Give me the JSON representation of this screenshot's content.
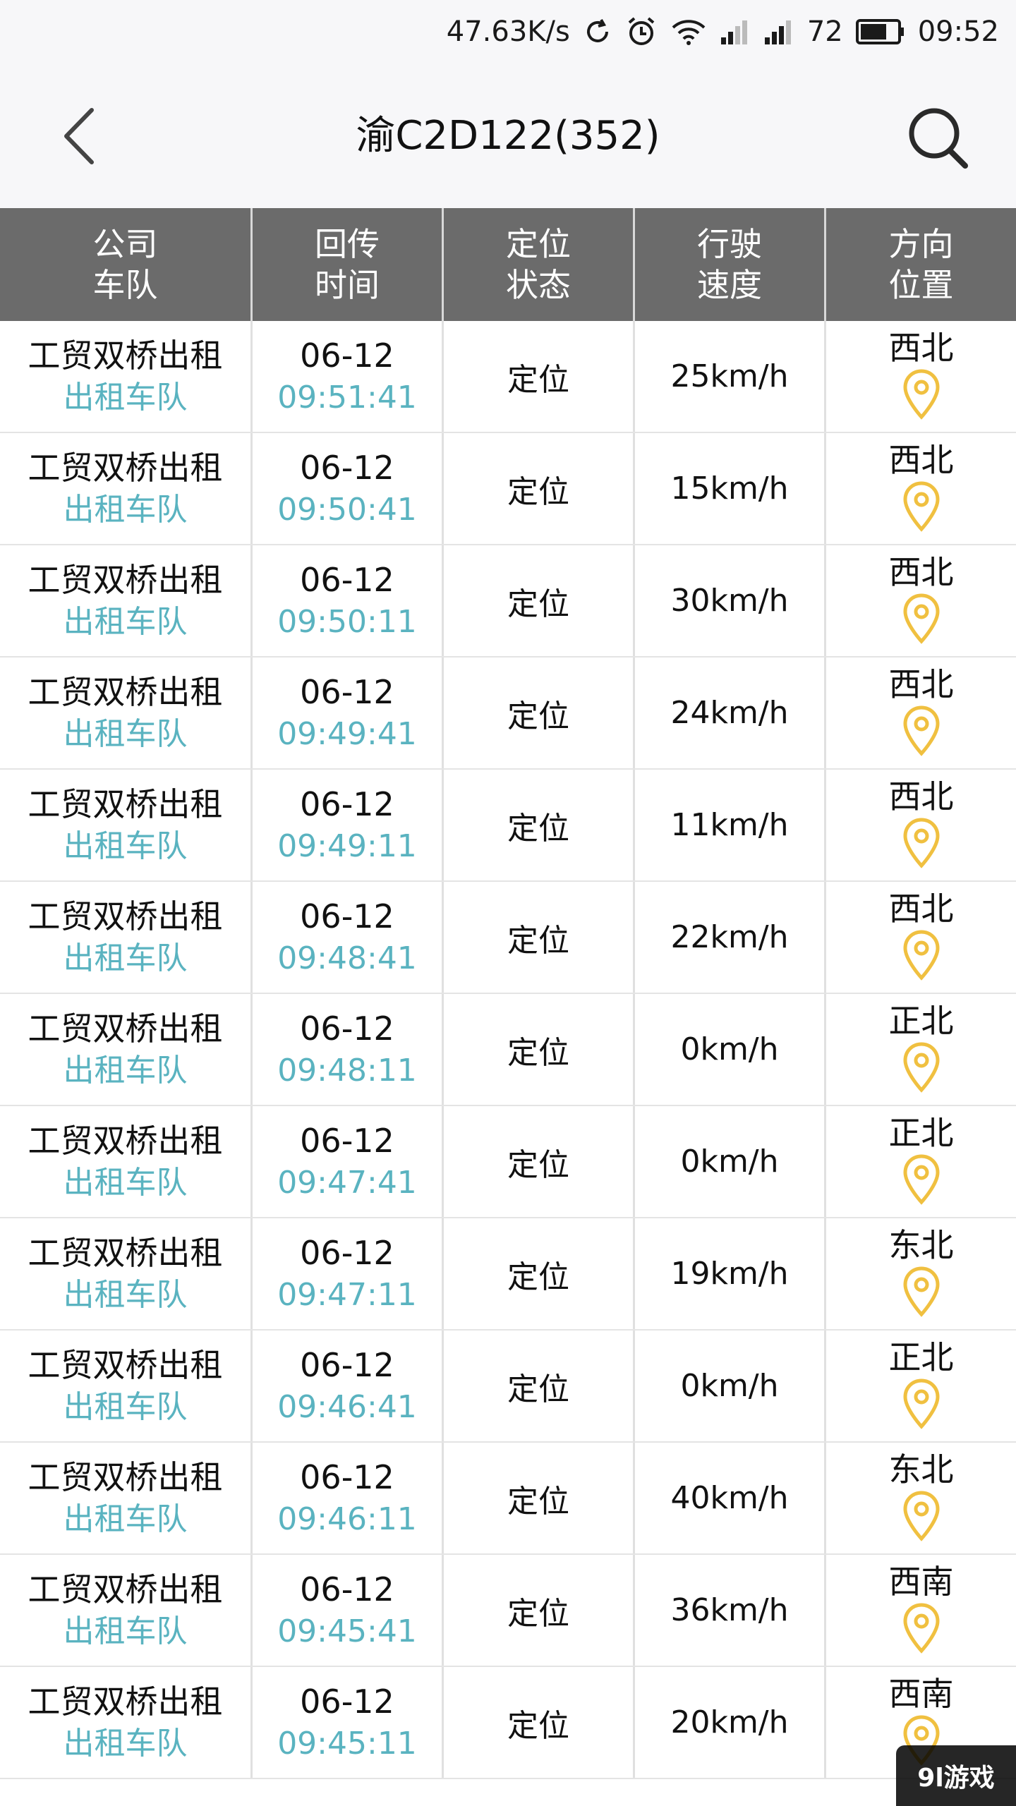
{
  "status_bar": {
    "net_speed": "47.63K/s",
    "battery": "72",
    "time": "09:52",
    "icons": [
      "sync-icon",
      "alarm-icon",
      "wifi-icon",
      "signal-1-icon",
      "signal-2-icon",
      "battery-icon"
    ]
  },
  "nav": {
    "title": "渝C2D122(352)",
    "back_icon": "chevron-left-icon",
    "search_icon": "search-icon"
  },
  "table": {
    "headers": [
      "公司\n车队",
      "回传\n时间",
      "定位\n状态",
      "行驶\n速度",
      "方向\n位置"
    ],
    "rows": [
      {
        "company": "工贸双桥出租",
        "team": "出租车队",
        "date": "06-12",
        "time": "09:51:41",
        "state": "定位",
        "speed": "25km/h",
        "direction": "西北"
      },
      {
        "company": "工贸双桥出租",
        "team": "出租车队",
        "date": "06-12",
        "time": "09:50:41",
        "state": "定位",
        "speed": "15km/h",
        "direction": "西北"
      },
      {
        "company": "工贸双桥出租",
        "team": "出租车队",
        "date": "06-12",
        "time": "09:50:11",
        "state": "定位",
        "speed": "30km/h",
        "direction": "西北"
      },
      {
        "company": "工贸双桥出租",
        "team": "出租车队",
        "date": "06-12",
        "time": "09:49:41",
        "state": "定位",
        "speed": "24km/h",
        "direction": "西北"
      },
      {
        "company": "工贸双桥出租",
        "team": "出租车队",
        "date": "06-12",
        "time": "09:49:11",
        "state": "定位",
        "speed": "11km/h",
        "direction": "西北"
      },
      {
        "company": "工贸双桥出租",
        "team": "出租车队",
        "date": "06-12",
        "time": "09:48:41",
        "state": "定位",
        "speed": "22km/h",
        "direction": "西北"
      },
      {
        "company": "工贸双桥出租",
        "team": "出租车队",
        "date": "06-12",
        "time": "09:48:11",
        "state": "定位",
        "speed": "0km/h",
        "direction": "正北"
      },
      {
        "company": "工贸双桥出租",
        "team": "出租车队",
        "date": "06-12",
        "time": "09:47:41",
        "state": "定位",
        "speed": "0km/h",
        "direction": "正北"
      },
      {
        "company": "工贸双桥出租",
        "team": "出租车队",
        "date": "06-12",
        "time": "09:47:11",
        "state": "定位",
        "speed": "19km/h",
        "direction": "东北"
      },
      {
        "company": "工贸双桥出租",
        "team": "出租车队",
        "date": "06-12",
        "time": "09:46:41",
        "state": "定位",
        "speed": "0km/h",
        "direction": "正北"
      },
      {
        "company": "工贸双桥出租",
        "team": "出租车队",
        "date": "06-12",
        "time": "09:46:11",
        "state": "定位",
        "speed": "40km/h",
        "direction": "东北"
      },
      {
        "company": "工贸双桥出租",
        "team": "出租车队",
        "date": "06-12",
        "time": "09:45:41",
        "state": "定位",
        "speed": "36km/h",
        "direction": "西南"
      },
      {
        "company": "工贸双桥出租",
        "team": "出租车队",
        "date": "06-12",
        "time": "09:45:11",
        "state": "定位",
        "speed": "20km/h",
        "direction": "西南"
      }
    ],
    "pin_icon": "location-pin-icon"
  },
  "colors": {
    "header_bg": "#6b6b6b",
    "team_text": "#5ab3c0",
    "pin": "#f0c040",
    "bar_bg": "#f7f7f9"
  },
  "watermark": "9l游戏"
}
